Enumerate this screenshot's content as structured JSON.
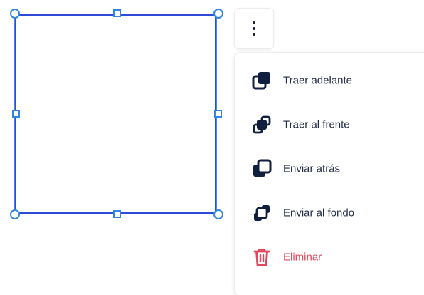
{
  "colors": {
    "selection": "#2f86e6",
    "shape_border": "#2f49d8",
    "icon": "#0f1f3d",
    "danger": "#e2475f"
  },
  "more_button": {
    "icon": "kebab-vertical-icon"
  },
  "menu": {
    "items": [
      {
        "label": "Traer adelante",
        "icon": "bring-forward-icon",
        "danger": false
      },
      {
        "label": "Traer al frente",
        "icon": "bring-to-front-icon",
        "danger": false
      },
      {
        "label": "Enviar atrás",
        "icon": "send-backward-icon",
        "danger": false
      },
      {
        "label": "Enviar al fondo",
        "icon": "send-to-back-icon",
        "danger": false
      },
      {
        "label": "Eliminar",
        "icon": "trash-icon",
        "danger": true
      }
    ]
  }
}
